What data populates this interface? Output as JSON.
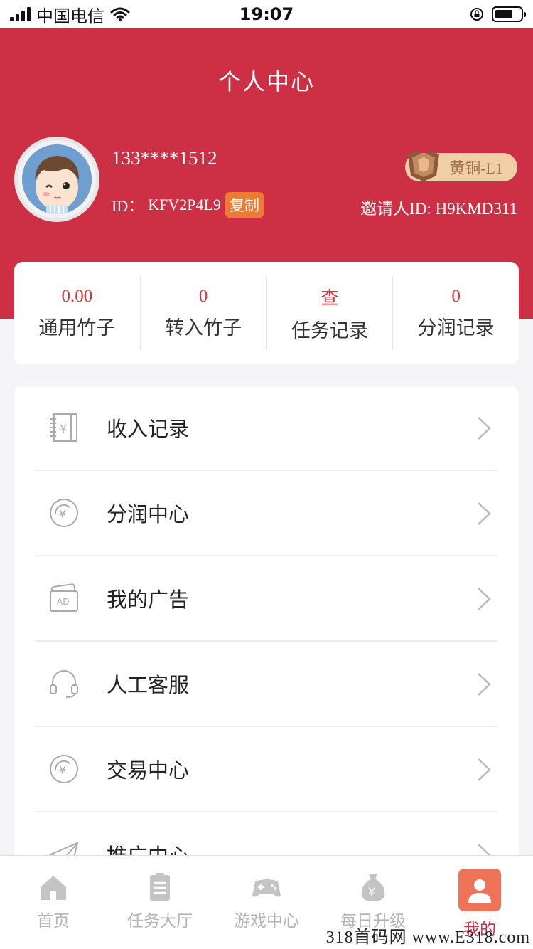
{
  "status_bar": {
    "carrier": "中国电信",
    "time": "19:07"
  },
  "header": {
    "title": "个人中心",
    "phone": "133****1512",
    "id_label": "ID：",
    "id_value": "KFV2P4L9",
    "copy_label": "复制",
    "level_badge": "黄铜-L1",
    "inviter": "邀请人ID: H9KMD311"
  },
  "stats": [
    {
      "value": "0.00",
      "label": "通用竹子"
    },
    {
      "value": "0",
      "label": "转入竹子"
    },
    {
      "value": "查",
      "label": "任务记录"
    },
    {
      "value": "0",
      "label": "分润记录"
    }
  ],
  "menu": [
    {
      "label": "收入记录",
      "icon": "ledger-yen-icon"
    },
    {
      "label": "分润中心",
      "icon": "yen-coin-icon"
    },
    {
      "label": "我的广告",
      "icon": "ad-card-icon"
    },
    {
      "label": "人工客服",
      "icon": "headset-icon"
    },
    {
      "label": "交易中心",
      "icon": "yen-coin-icon"
    },
    {
      "label": "推广中心",
      "icon": "paper-plane-icon"
    }
  ],
  "tabbar": [
    {
      "label": "首页",
      "icon": "home-icon"
    },
    {
      "label": "任务大厅",
      "icon": "clipboard-icon"
    },
    {
      "label": "游戏中心",
      "icon": "gamepad-icon"
    },
    {
      "label": "每日升级",
      "icon": "money-bag-icon"
    },
    {
      "label": "我的",
      "icon": "user-icon",
      "active": true
    }
  ],
  "watermark": "318首码网 www.E318.com",
  "colors": {
    "brand_red": "#cd2f45",
    "copy_orange": "#ee7b31",
    "badge_bg": "#f1cfa6",
    "stat_value_red": "#d9323b",
    "tab_active_bg": "#ef7359"
  }
}
